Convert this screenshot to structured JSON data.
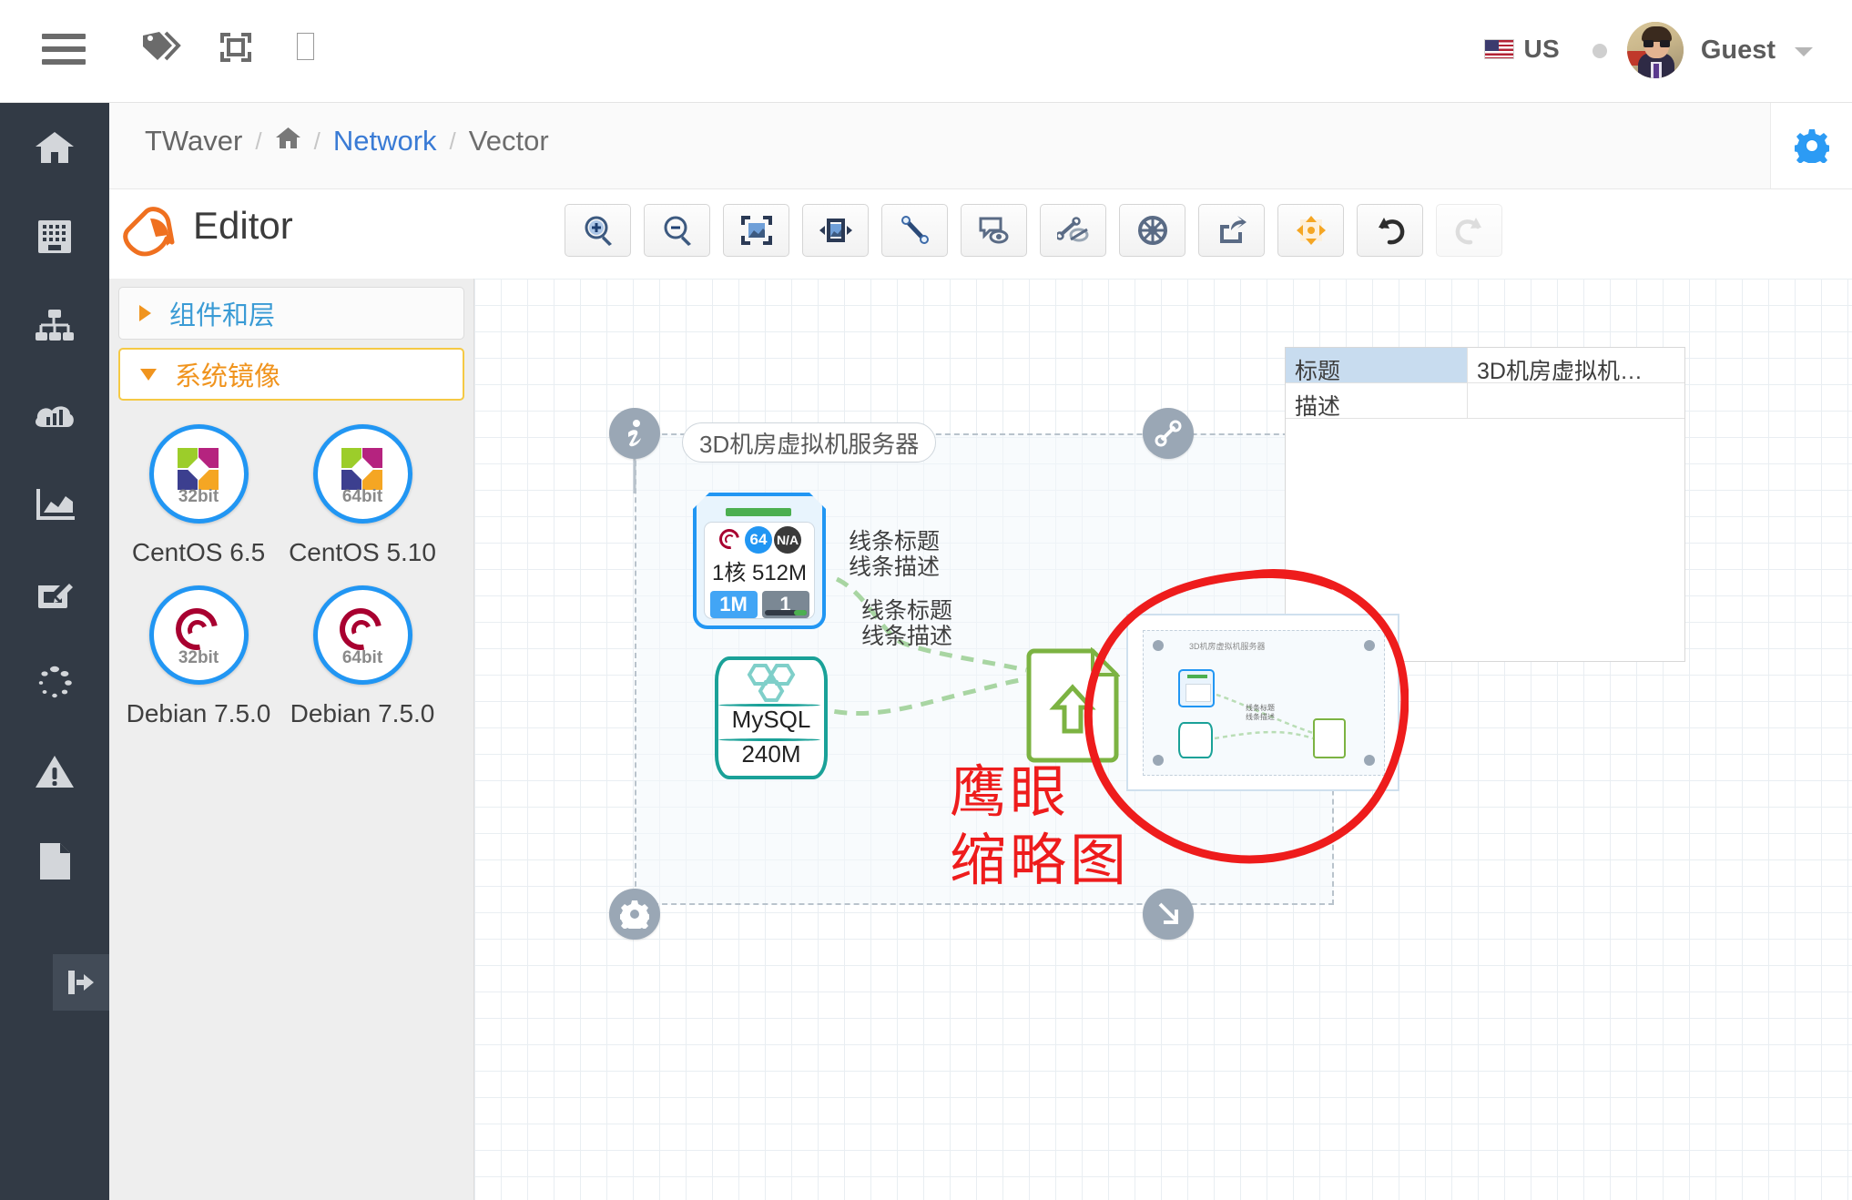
{
  "topbar": {
    "hamburger_name": "menu-toggle",
    "icons": [
      "menu-icon",
      "tag-icon",
      "frame-icon",
      "missing-glyph-icon"
    ],
    "locale_label": "US",
    "user_name": "Guest"
  },
  "rail": {
    "items": [
      {
        "name": "home",
        "icon": "home-icon"
      },
      {
        "name": "datacenter",
        "icon": "building-icon"
      },
      {
        "name": "topology",
        "icon": "network-tree-icon"
      },
      {
        "name": "cloud-stats",
        "icon": "cloud-bars-icon"
      },
      {
        "name": "analytics",
        "icon": "area-chart-icon"
      },
      {
        "name": "editor",
        "icon": "pencil-board-icon"
      },
      {
        "name": "loading",
        "icon": "dots-circle-icon"
      },
      {
        "name": "alarms",
        "icon": "warning-triangle-icon"
      },
      {
        "name": "reports",
        "icon": "document-icon"
      }
    ],
    "collapse_icon": "collapse-arrow-icon"
  },
  "breadcrumb": {
    "root": "TWaver",
    "home_icon": "home-icon",
    "sep": "/",
    "link": "Network",
    "current": "Vector",
    "settings_icon": "gear-icon"
  },
  "editor": {
    "logo_icon": "twaver-editor-logo-icon",
    "title": "Editor",
    "toolbar": [
      {
        "name": "zoom-in",
        "icon": "magnifier-plus-icon",
        "disabled": false
      },
      {
        "name": "zoom-out",
        "icon": "magnifier-minus-icon",
        "disabled": false
      },
      {
        "name": "zoom-overview",
        "icon": "fit-window-icon",
        "disabled": false
      },
      {
        "name": "fit-width",
        "icon": "fit-width-icon",
        "disabled": false
      },
      {
        "name": "create-link",
        "icon": "line-link-icon",
        "disabled": false
      },
      {
        "name": "toggle-tooltip",
        "icon": "tooltip-eye-icon",
        "disabled": false
      },
      {
        "name": "toggle-links",
        "icon": "link-hidden-icon",
        "disabled": false
      },
      {
        "name": "layout-wheel",
        "icon": "compass-wheel-icon",
        "disabled": false
      },
      {
        "name": "export",
        "icon": "export-share-icon",
        "disabled": false
      },
      {
        "name": "pan-move",
        "icon": "move-arrows-icon",
        "disabled": false
      },
      {
        "name": "undo",
        "icon": "undo-icon",
        "disabled": false
      },
      {
        "name": "redo",
        "icon": "redo-icon",
        "disabled": true
      }
    ]
  },
  "palette": {
    "sections": [
      {
        "label": "组件和层",
        "open": false,
        "caret": "caret-right-icon"
      },
      {
        "label": "系统镜像",
        "open": true,
        "caret": "caret-down-icon"
      }
    ],
    "images": [
      {
        "label": "CentOS 6.5",
        "bits": "32bit",
        "os": "centos"
      },
      {
        "label": "CentOS 5.10",
        "bits": "64bit",
        "os": "centos"
      },
      {
        "label": "Debian 7.5.0",
        "bits": "32bit",
        "os": "debian"
      },
      {
        "label": "Debian 7.5.0",
        "bits": "64bit",
        "os": "debian"
      }
    ]
  },
  "canvas": {
    "node_label": "3D机房虚拟机服务器",
    "handles": [
      {
        "name": "info-handle",
        "icon": "info-icon"
      },
      {
        "name": "link-handle",
        "icon": "link-nodes-icon"
      },
      {
        "name": "gear-handle",
        "icon": "gear-icon"
      },
      {
        "name": "resize-handle",
        "icon": "resize-arrow-icon"
      }
    ],
    "server_node": {
      "os_icon": "debian-swirl-icon",
      "arch_badge": "64",
      "state_badge": "N/A",
      "spec": "1核 512M",
      "chip_bandwidth": "1M",
      "chip_count": "1"
    },
    "db_node": {
      "logo_icon": "mysql-dolphin-hex-icon",
      "name": "MySQL",
      "size": "240M"
    },
    "doc_node": {
      "icon": "document-upload-icon"
    },
    "link_labels": [
      {
        "title": "线条标题",
        "desc": "线条描述"
      },
      {
        "title": "线条标题",
        "desc": "线条描述"
      }
    ]
  },
  "properties": {
    "rows": [
      {
        "key": "标题",
        "value": "3D机房虚拟机…",
        "highlight": true
      },
      {
        "key": "描述",
        "value": "",
        "highlight": false
      }
    ]
  },
  "overview": {
    "mini_label": "3D机房虚拟机服务器",
    "mini_link_label": "线条标题\n线条描述"
  },
  "annotation": {
    "line1": "鹰眼",
    "line2": "缩略图",
    "color": "#ee1c1c"
  }
}
